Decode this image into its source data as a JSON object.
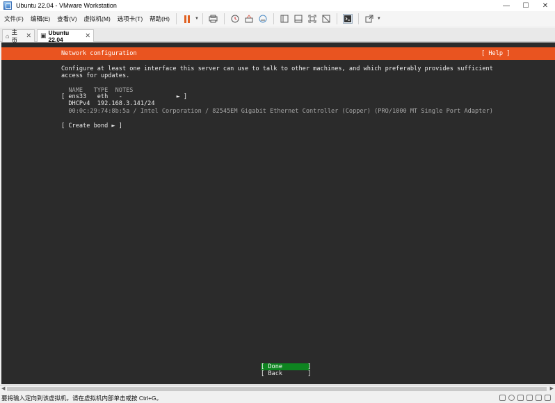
{
  "window": {
    "title": "Ubuntu 22.04 - VMware Workstation",
    "min": "—",
    "max": "☐",
    "close": "✕"
  },
  "menu": [
    "文件(F)",
    "编辑(E)",
    "查看(V)",
    "虚拟机(M)",
    "选项卡(T)",
    "帮助(H)"
  ],
  "tabs": [
    {
      "label": "主页",
      "icon": "home-icon"
    },
    {
      "label": "Ubuntu 22.04",
      "icon": "vm-icon"
    }
  ],
  "console": {
    "header_title": "Network configuration",
    "header_help": "[ Help ]",
    "desc_line1": "Configure at least one interface this server can use to talk to other machines, and which preferably provides sufficient",
    "desc_line2": "access for updates.",
    "col_headers": "  NAME   TYPE  NOTES",
    "iface_row": "[ ens33   eth   -               ► ]",
    "dhcp_row": "  DHCPv4  192.168.3.141/24",
    "mac_row": "  00:0c:29:74:8b:5a / Intel Corporation / 82545EM Gigabit Ethernet Controller (Copper) (PRO/1000 MT Single Port Adapter)",
    "create_bond": "[ Create bond ► ]",
    "done_button": "[ Done       ]",
    "back_button": "[ Back       ]"
  },
  "status": {
    "text": "要将输入定向到该虚拟机，请在虚拟机内部单击或按 Ctrl+G。"
  },
  "colors": {
    "ubuntu_orange": "#e95420",
    "done_green": "#0e8420",
    "console_bg": "#2b2b2b"
  }
}
